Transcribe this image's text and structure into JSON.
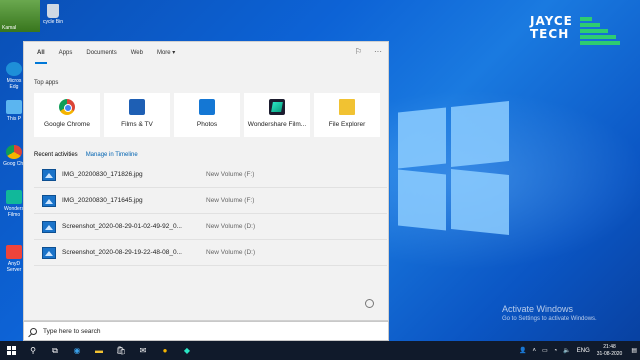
{
  "desktop": {
    "top_thumb_label": "Kamal",
    "recycle_label": "cycle Bin",
    "icons": [
      "Micros Edg",
      "This P",
      "Goog Chr",
      "Wonders Filmo",
      "AnyD Server"
    ],
    "brand": {
      "line1": "JAYCE",
      "line2": "TECH",
      "accent": "#2ecc71"
    },
    "activate": {
      "title": "Activate Windows",
      "subtitle": "Go to Settings to activate Windows."
    }
  },
  "search_panel": {
    "tabs": [
      {
        "label": "All",
        "active": true
      },
      {
        "label": "Apps",
        "active": false
      },
      {
        "label": "Documents",
        "active": false
      },
      {
        "label": "Web",
        "active": false
      },
      {
        "label": "More ▾",
        "active": false
      }
    ],
    "top_apps_title": "Top apps",
    "top_apps": [
      {
        "label": "Google Chrome",
        "icon": "chrome-icon"
      },
      {
        "label": "Films & TV",
        "icon": "films-tv-icon"
      },
      {
        "label": "Photos",
        "icon": "photos-icon"
      },
      {
        "label": "Wondershare Film...",
        "icon": "wondershare-filmora-icon"
      },
      {
        "label": "File Explorer",
        "icon": "file-explorer-icon"
      }
    ],
    "recent_title": "Recent activities",
    "recent_link": "Manage in Timeline",
    "recent": [
      {
        "name": "IMG_20200830_171826.jpg",
        "location": "New Volume (F:)"
      },
      {
        "name": "IMG_20200830_171645.jpg",
        "location": "New Volume (F:)"
      },
      {
        "name": "Screenshot_2020-08-29-01-02-49-92_0...",
        "location": "New Volume (D:)"
      },
      {
        "name": "Screenshot_2020-08-29-19-22-48-08_0...",
        "location": "New Volume (D:)"
      }
    ],
    "search_placeholder": "Type here to search"
  },
  "taskbar": {
    "tray": {
      "lang": "ENG",
      "time": "21:48",
      "date": "31-08-2020"
    }
  },
  "colors": {
    "accent": "#0078d7",
    "taskbar": "#101a2b",
    "panel_bg": "#f2f2f2"
  }
}
